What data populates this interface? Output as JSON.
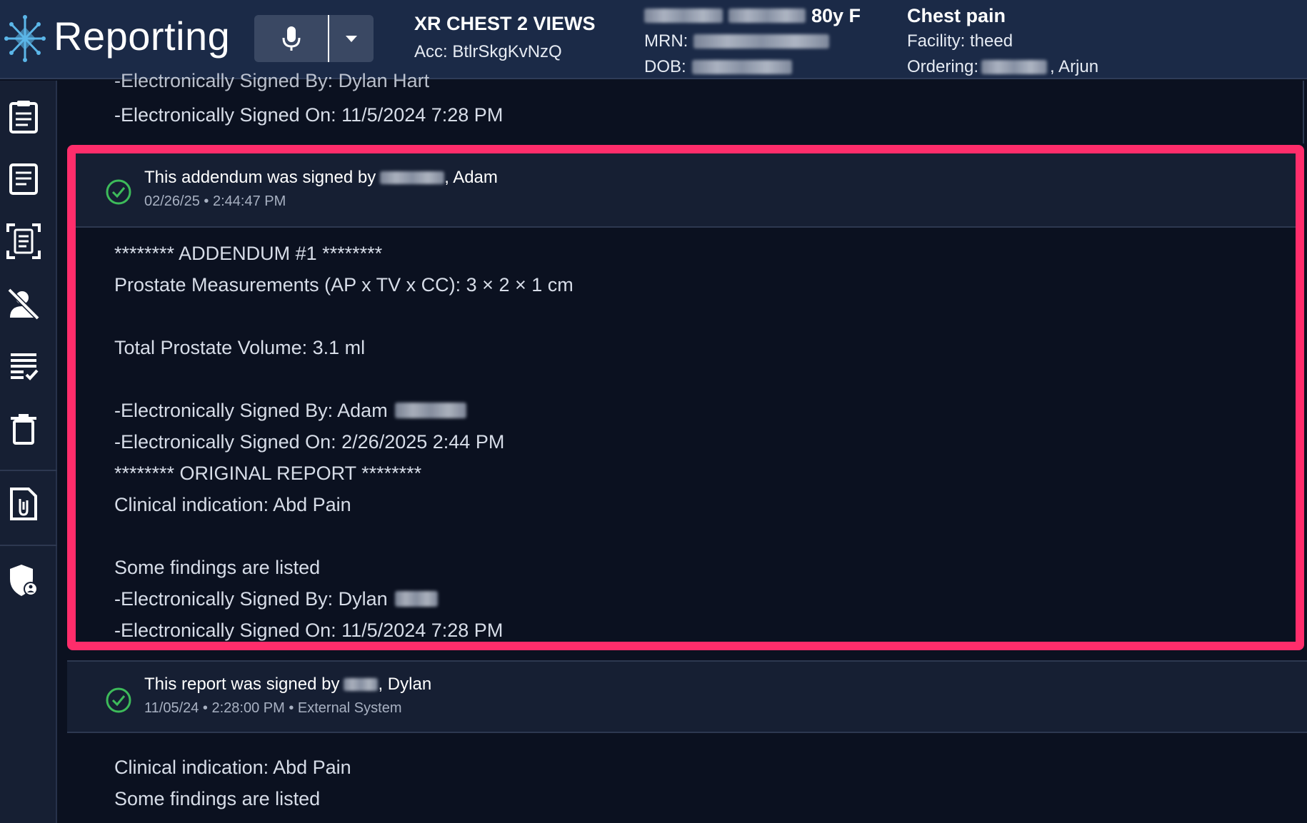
{
  "app": {
    "brand": "Reporting"
  },
  "exam": {
    "title": "XR CHEST 2 VIEWS",
    "accession": "Acc: BtlrSkgKvNzQ"
  },
  "patient": {
    "age_sex": "80y F",
    "mrn_label": "MRN:",
    "dob_label": "DOB:"
  },
  "order": {
    "reason": "Chest pain",
    "facility": "Facility: theed",
    "ordering_label": "Ordering:",
    "ordering_suffix": ", Arjun"
  },
  "sidebar": {
    "icons": [
      "clipboard-icon",
      "document-icon",
      "scan-document-icon",
      "user-off-icon",
      "checklist-icon",
      "trash-icon",
      "attachment-icon",
      "shield-user-icon"
    ]
  },
  "top_report": {
    "partial_line": "-Electronically Signed By: Dylan Hart",
    "signed_on": "-Electronically Signed On: 11/5/2024 7:28 PM"
  },
  "addendum": {
    "signed_by_prefix": "This addendum was signed by",
    "signed_by_suffix": ", Adam",
    "meta": "02/26/25 • 2:44:47 PM",
    "lines": [
      "******** ADDENDUM #1 ********",
      "Prostate Measurements (AP x TV x CC): 3 × 2 × 1 cm",
      "",
      "Total Prostate Volume: 3.1 ml",
      "",
      "-Electronically Signed By: Adam",
      "-Electronically Signed On: 2/26/2025 2:44 PM",
      "******** ORIGINAL REPORT ********",
      "Clinical indication:  Abd Pain",
      "",
      "Some findings are listed",
      "-Electronically Signed By: Dylan",
      "-Electronically Signed On: 11/5/2024 7:28 PM"
    ]
  },
  "report": {
    "signed_by_prefix": "This report was signed by",
    "signed_by_suffix": ", Dylan",
    "meta": "11/05/24 • 2:28:00 PM • External System",
    "lines": [
      "Clinical indication:  Abd Pain",
      "Some findings are listed"
    ]
  },
  "colors": {
    "header_bg": "#1b2a47",
    "highlight": "#ff2d6b",
    "check": "#3dbb5a"
  }
}
